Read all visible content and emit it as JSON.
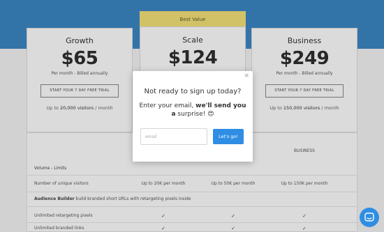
{
  "plans": {
    "badge": "Best Value",
    "growth": {
      "name": "Growth",
      "price": "$65",
      "billing": "Per month - Billed annually",
      "cta": "START YOUR 7 DAY FREE TRIAL",
      "visitors_prefix": "Up to ",
      "visitors_count": "20,000 visitors",
      "visitors_suffix": " / month"
    },
    "scale": {
      "name": "Scale",
      "price": "$124"
    },
    "business": {
      "name": "Business",
      "price": "$249",
      "billing": "Per month - Billed annually",
      "cta": "START YOUR 7 DAY FREE TRIAL",
      "visitors_prefix": "Up to ",
      "visitors_count": "150,000 visitors",
      "visitors_suffix": " / month"
    }
  },
  "table": {
    "business_header": "BUSINESS",
    "section_volume": "Volume - Limits",
    "unique_visitors": {
      "label": "Number of unique visitors",
      "growth": "Up to 20K per month",
      "scale": "Up to 50K per month",
      "business": "Up to 150K per month"
    },
    "audience_builder": {
      "title": "Audience Builder",
      "desc": " build branded short URLs with retargeting pixels inside"
    },
    "retargeting_pixels": {
      "label": "Unlimited retargeting pixels",
      "check": "✓"
    },
    "branded_links": {
      "label": "Unlimited branded links",
      "check": "✓"
    }
  },
  "modal": {
    "close": "×",
    "title": "Not ready to sign up today?",
    "body_prefix": "Enter your email, ",
    "body_bold": "we'll send you a",
    "body_rest": " surprise! 😍",
    "email_placeholder": "email",
    "submit": "Let's go!"
  },
  "colors": {
    "hero": "#3c87c4",
    "badge": "#f4e27a",
    "primary_button": "#2f8de4"
  },
  "icons": {
    "close": "close-icon",
    "checkmark": "checkmark-icon",
    "chat": "chat-icon"
  }
}
